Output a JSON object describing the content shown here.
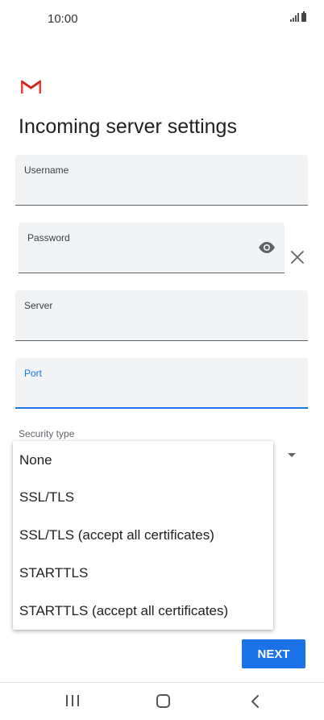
{
  "status_bar": {
    "time": "10:00"
  },
  "header": {
    "title": "Incoming server settings"
  },
  "form": {
    "username": {
      "label": "Username",
      "value": ""
    },
    "password": {
      "label": "Password",
      "value": ""
    },
    "server": {
      "label": "Server",
      "value": ""
    },
    "port": {
      "label": "Port",
      "value": ""
    },
    "security_type": {
      "label": "Security type"
    }
  },
  "security_menu": {
    "options": [
      "None",
      "SSL/TLS",
      "SSL/TLS (accept all certificates)",
      "STARTTLS",
      "STARTTLS (accept all certificates)"
    ]
  },
  "actions": {
    "next_label": "NEXT"
  },
  "colors": {
    "accent": "#1a73e8",
    "field_bg": "#f1f3f4",
    "gmail_red": "#ea4335"
  },
  "icons": [
    "gmail-logo",
    "eye-icon",
    "clear-icon",
    "dropdown-arrow-icon",
    "recents-icon",
    "home-icon",
    "back-icon"
  ]
}
